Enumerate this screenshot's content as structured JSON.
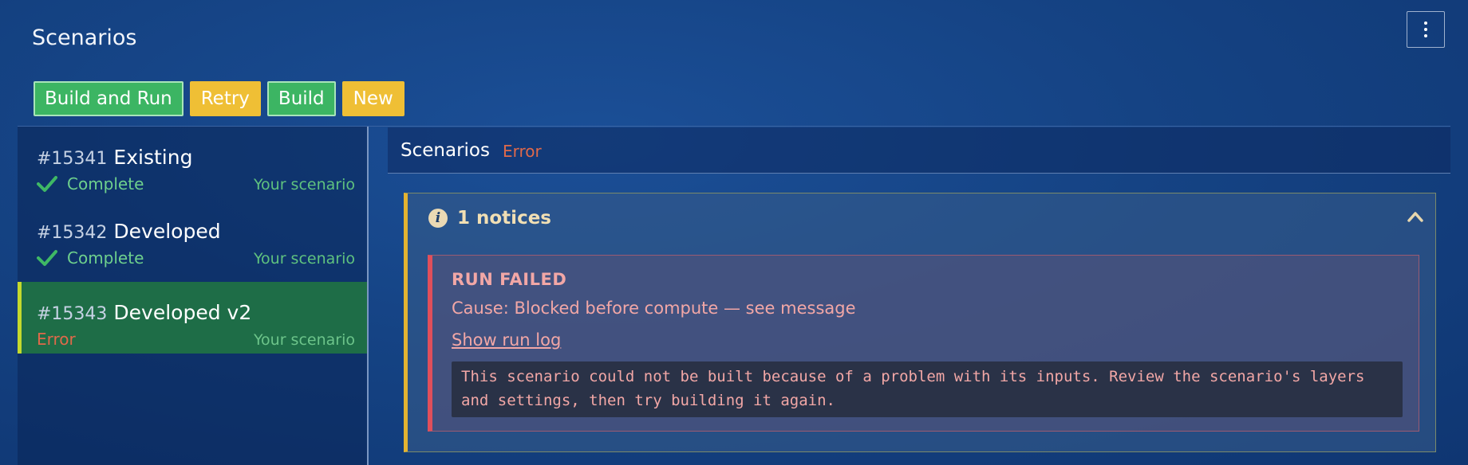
{
  "header": {
    "title": "Scenarios",
    "menu_icon": "kebab-menu-icon"
  },
  "toolbar": {
    "build_and_run_label": "Build and Run",
    "retry_label": "Retry",
    "build_label": "Build",
    "new_label": "New"
  },
  "sidebar": {
    "items": [
      {
        "number": "#15341",
        "name": "Existing",
        "status": "Complete",
        "owner": "Your scenario"
      },
      {
        "number": "#15342",
        "name": "Developed",
        "status": "Complete",
        "owner": "Your scenario"
      },
      {
        "number": "#15343",
        "name": "Developed v2",
        "status": "Error",
        "owner": "Your scenario"
      }
    ]
  },
  "main": {
    "title": "Scenarios",
    "status": "Error",
    "notices": {
      "title": "1 notices",
      "error": {
        "title": "RUN FAILED",
        "cause": "Cause: Blocked before compute — see message",
        "log_link": "Show run log",
        "message": "This scenario could not be built because of a problem with its inputs. Review the scenario's layers and settings, then try building it again."
      }
    }
  },
  "colors": {
    "green_button": "#3cb563",
    "yellow_button": "#efbf35",
    "complete": "#6ed08d",
    "error": "#e0694a",
    "active_row": "#1e6d47"
  }
}
